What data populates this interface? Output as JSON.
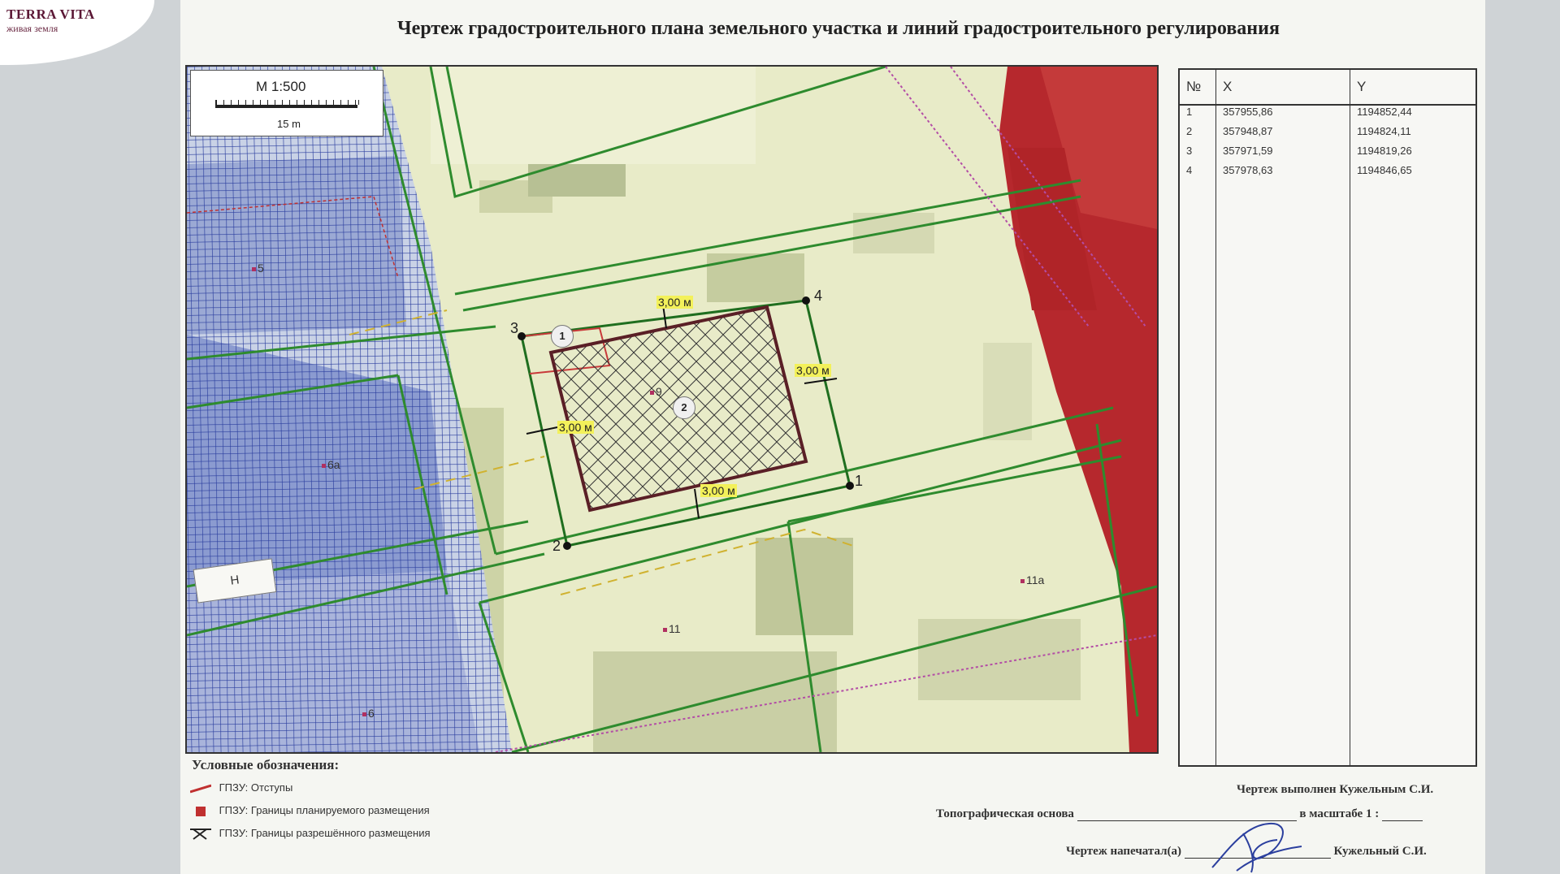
{
  "logo": {
    "name": "TERRA VITA",
    "tagline": "живая земля"
  },
  "title": "Чертеж градостроительного плана земельного участка и линий градостроительного регулирования",
  "map": {
    "scale_label": "М 1:500",
    "scale_length": "15 m",
    "points": [
      "1",
      "2",
      "3",
      "4"
    ],
    "zones": [
      "1",
      "2"
    ],
    "setback_labels": [
      "3,00 м",
      "3,00 м",
      "3,00 м",
      "3,00 м"
    ],
    "parcels": [
      "5",
      "6а",
      "9",
      "11",
      "11а",
      "6"
    ],
    "building": "Н"
  },
  "coords": {
    "headers": [
      "№",
      "X",
      "Y"
    ],
    "rows": [
      [
        "1",
        "357955,86",
        "1194852,44"
      ],
      [
        "2",
        "357948,87",
        "1194824,11"
      ],
      [
        "3",
        "357971,59",
        "1194819,26"
      ],
      [
        "4",
        "357978,63",
        "1194846,65"
      ]
    ]
  },
  "legend": {
    "title": "Условные обозначения:",
    "items": [
      {
        "label": "ГПЗУ: Отступы",
        "color": "#c03030"
      },
      {
        "label": "ГПЗУ: Границы планируемого размещения",
        "color": "#c03030"
      },
      {
        "label": "ГПЗУ: Границы разрешённого размещения",
        "color": "#222222"
      }
    ]
  },
  "footer": {
    "drawn_by": "Чертеж выполнен Кужельным С.И.",
    "topo": "Топографическая основа",
    "scale": "в масштабе 1 :",
    "printed": "Чертеж напечатал(а)",
    "printed_name": "Кужельный С.И."
  }
}
